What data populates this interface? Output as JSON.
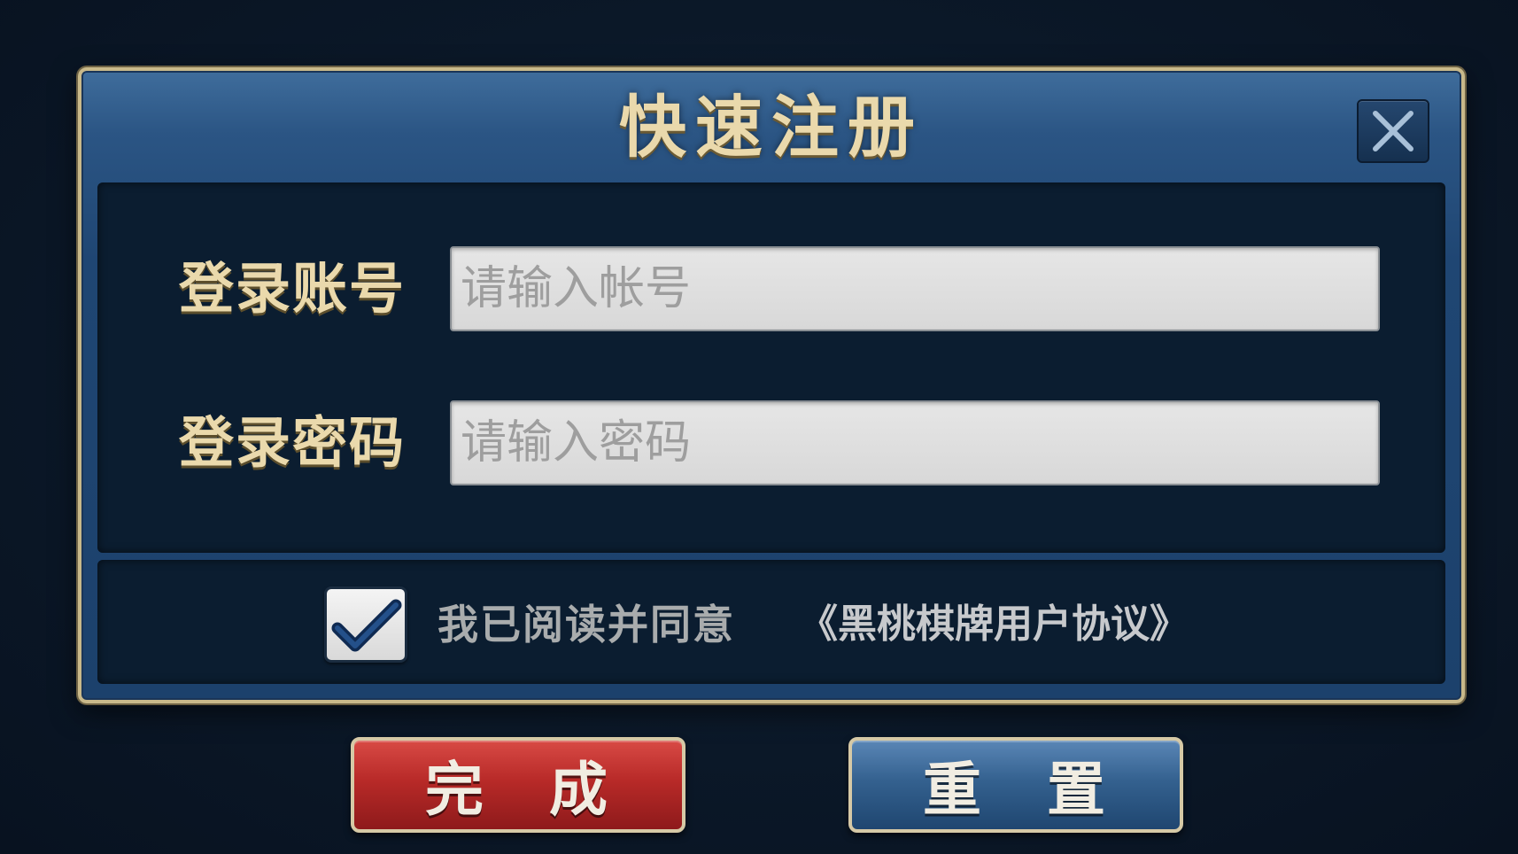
{
  "dialog": {
    "title": "快速注册",
    "close_icon": "close-icon"
  },
  "form": {
    "account": {
      "label": "登录账号",
      "placeholder": "请输入帐号",
      "value": ""
    },
    "password": {
      "label": "登录密码",
      "placeholder": "请输入密码",
      "value": ""
    }
  },
  "agreement": {
    "checked": true,
    "check_icon": "checkmark-icon",
    "text": "我已阅读并同意",
    "link": "《黑桃棋牌用户协议》"
  },
  "buttons": {
    "finish_label": "完　成",
    "reset_label": "重　置"
  },
  "colors": {
    "title_gold": "#ead9ac",
    "finish_red": "#b82a28",
    "reset_blue": "#34618f",
    "panel_dark": "#0b1d30"
  }
}
